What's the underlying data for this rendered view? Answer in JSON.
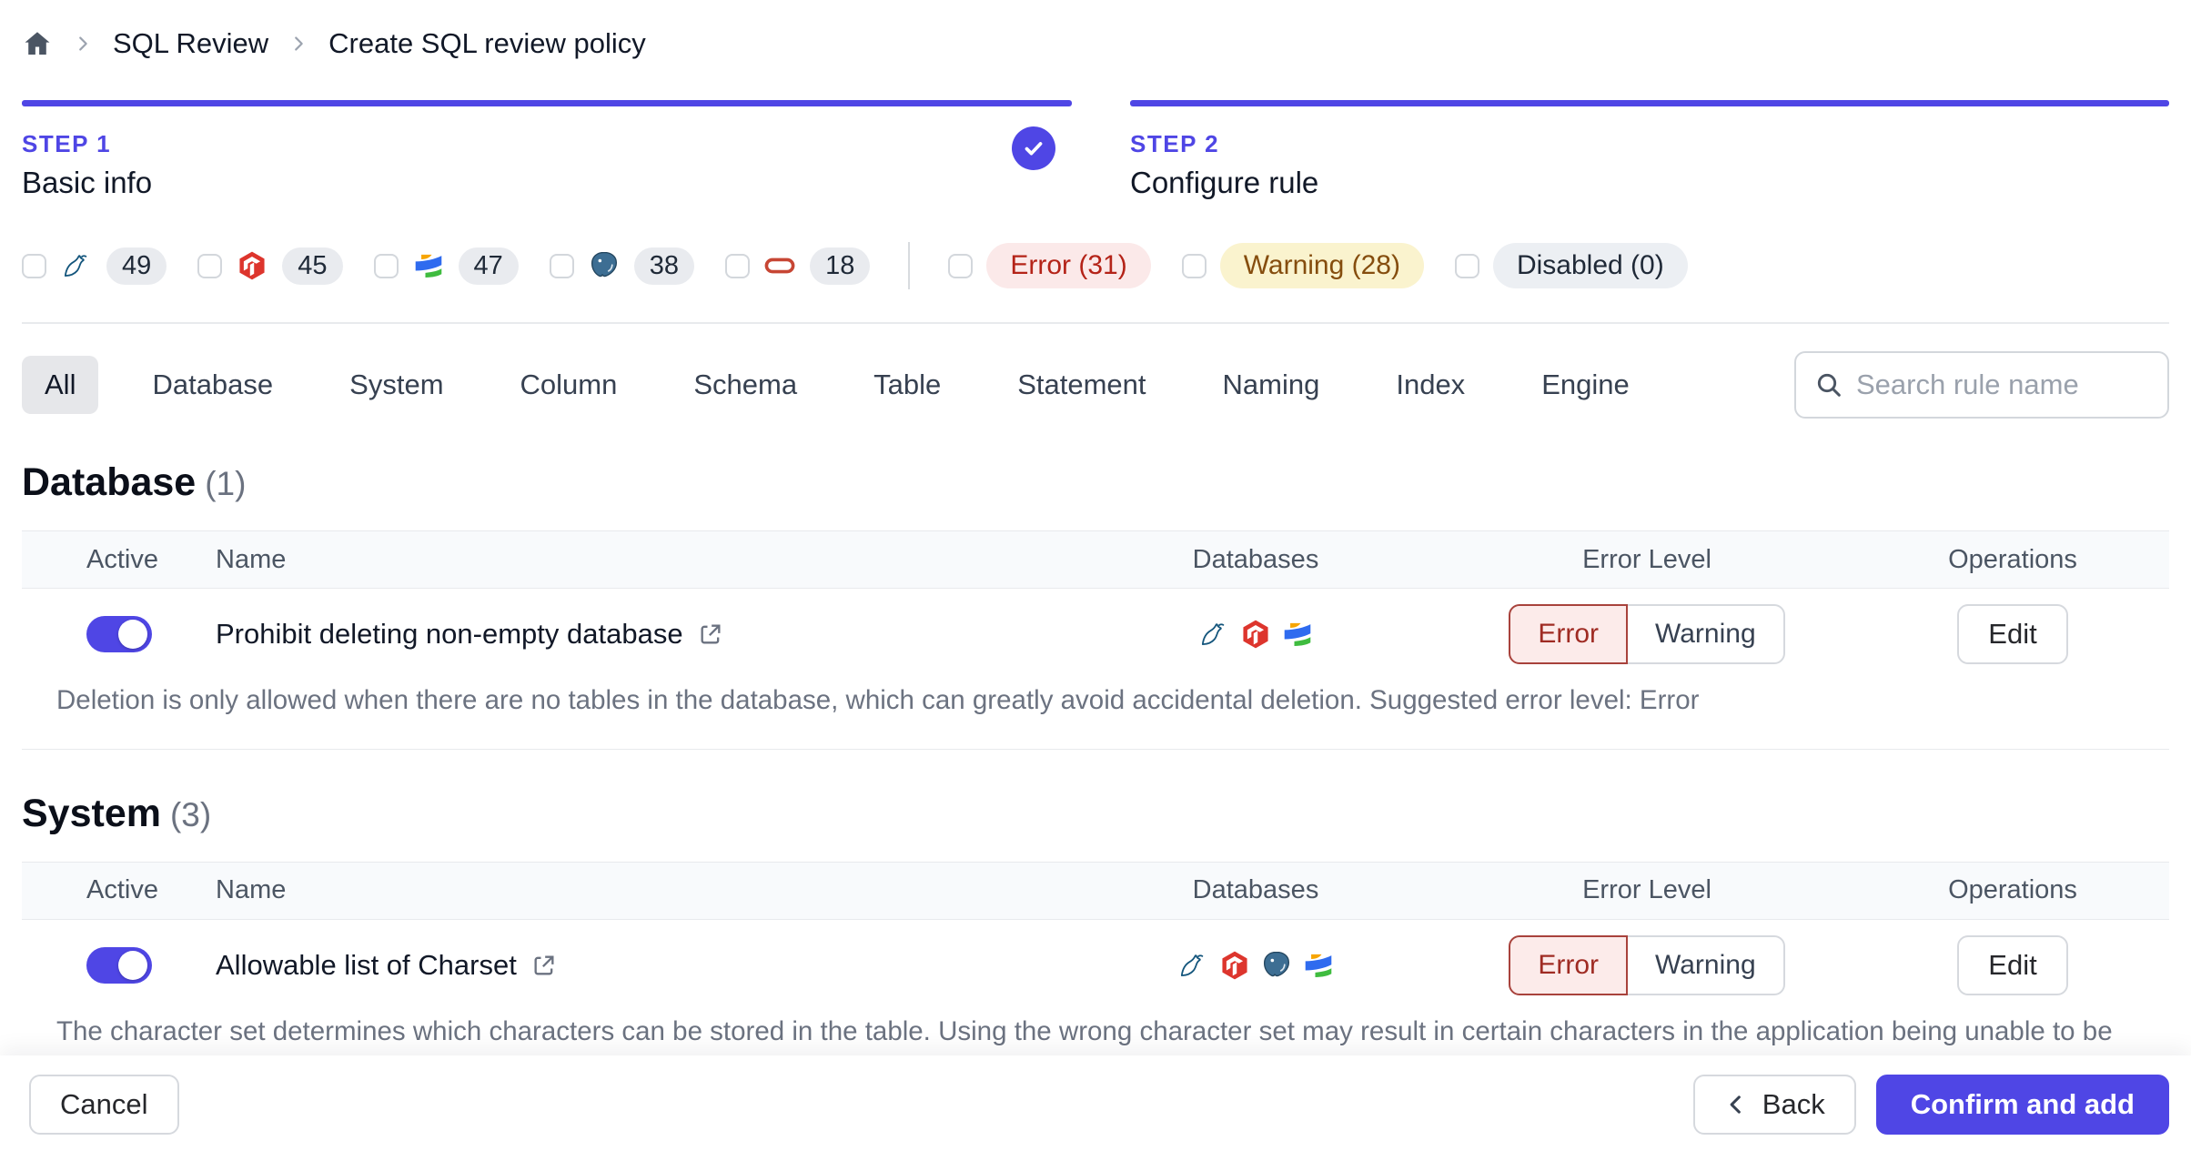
{
  "breadcrumb": {
    "items": [
      "SQL Review",
      "Create SQL review policy"
    ]
  },
  "steps": [
    {
      "label": "STEP 1",
      "title": "Basic info",
      "completed": true
    },
    {
      "label": "STEP 2",
      "title": "Configure rule",
      "completed": false
    }
  ],
  "filters": {
    "engines": [
      {
        "icon": "mysql-icon",
        "count": "49"
      },
      {
        "icon": "tidb-icon",
        "count": "45"
      },
      {
        "icon": "oceanbase-icon",
        "count": "47"
      },
      {
        "icon": "postgres-icon",
        "count": "38"
      },
      {
        "icon": "oracle-icon",
        "count": "18"
      }
    ],
    "levels": [
      {
        "label": "Error (31)",
        "style": "error"
      },
      {
        "label": "Warning (28)",
        "style": "warning"
      },
      {
        "label": "Disabled (0)",
        "style": "disabled"
      }
    ]
  },
  "tabs": {
    "items": [
      "All",
      "Database",
      "System",
      "Column",
      "Schema",
      "Table",
      "Statement",
      "Naming",
      "Index",
      "Engine"
    ],
    "active": "All"
  },
  "search": {
    "placeholder": "Search rule name",
    "value": ""
  },
  "table_columns": [
    "Active",
    "Name",
    "Databases",
    "Error Level",
    "Operations"
  ],
  "sections": [
    {
      "title": "Database",
      "count": "(1)",
      "rules": [
        {
          "name": "Prohibit deleting non-empty database",
          "active": true,
          "engines": [
            "mysql-icon",
            "tidb-icon",
            "oceanbase-icon"
          ],
          "error_level": {
            "options": [
              "Error",
              "Warning"
            ],
            "selected": "Error"
          },
          "description": "Deletion is only allowed when there are no tables in the database, which can greatly avoid accidental deletion. Suggested error level: Error"
        }
      ]
    },
    {
      "title": "System",
      "count": "(3)",
      "rules": [
        {
          "name": "Allowable list of Charset",
          "active": true,
          "engines": [
            "mysql-icon",
            "tidb-icon",
            "postgres-icon",
            "oceanbase-icon"
          ],
          "error_level": {
            "options": [
              "Error",
              "Warning"
            ],
            "selected": "Error"
          },
          "description": "The character set determines which characters can be stored in the table. Using the wrong character set may result in certain characters in the application being unable to be stored and displayed correctly, such as CJK and Emoji. Suggested error level: Error"
        }
      ]
    }
  ],
  "operations": {
    "edit_label": "Edit"
  },
  "footer": {
    "cancel_label": "Cancel",
    "back_label": "Back",
    "confirm_label": "Confirm and add"
  },
  "colors": {
    "accent": "#4f46e5",
    "error_text": "#b42318",
    "error_bg": "#fbe9e9",
    "warning_text": "#854d0e",
    "warning_bg": "#faf3ce"
  }
}
